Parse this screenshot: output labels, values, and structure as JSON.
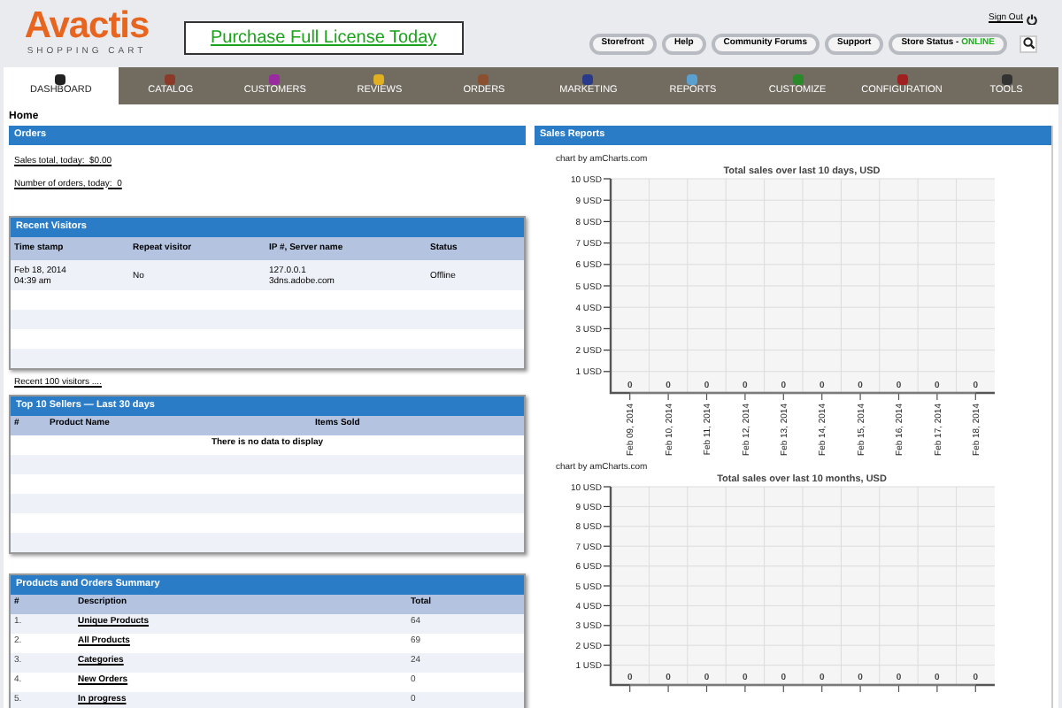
{
  "header": {
    "logo": "Avactis",
    "logo_subtitle": "SHOPPING CART",
    "banner": "Purchase Full License Today",
    "sign_out": "Sign Out",
    "buttons": [
      "Storefront",
      "Help",
      "Community Forums",
      "Support"
    ],
    "store_status": {
      "label": "Store Status - ",
      "status": "ONLINE"
    }
  },
  "tabs": [
    {
      "label": "DASHBOARD",
      "selected": true
    },
    {
      "label": "CATALOG",
      "selected": false
    },
    {
      "label": "CUSTOMERS",
      "selected": false
    },
    {
      "label": "REVIEWS",
      "selected": false
    },
    {
      "label": "ORDERS",
      "selected": false
    },
    {
      "label": "MARKETING",
      "selected": false
    },
    {
      "label": "REPORTS",
      "selected": false
    },
    {
      "label": "CUSTOMIZE",
      "selected": false
    },
    {
      "label": "CONFIGURATION",
      "selected": false
    },
    {
      "label": "TOOLS",
      "selected": false
    }
  ],
  "breadcrumb": "Home",
  "orders": {
    "title": "Orders",
    "links": [
      "Sales total, today:  $0.00",
      "Number of orders, today:  0"
    ]
  },
  "recent_visitors": {
    "title": "Recent Visitors",
    "columns": [
      "Time stamp",
      "Repeat visitor",
      "IP #, Server name",
      "Status"
    ],
    "rows": [
      {
        "cells": [
          [
            "Feb 18, 2014",
            "04:39 am"
          ],
          [
            "No"
          ],
          [
            "127.0.0.1",
            "3dns.adobe.com"
          ],
          [
            "Offline"
          ]
        ]
      }
    ],
    "link": "Recent 100 visitors ...."
  },
  "top_sellers": {
    "title": "Top 10 Sellers — Last 30 days",
    "columns": [
      "#",
      "Product Name",
      "Items Sold"
    ],
    "message": "There is no data to display"
  },
  "summary": {
    "title": "Products and Orders Summary",
    "columns": [
      "#",
      "Description",
      "Total"
    ],
    "rows": [
      {
        "num": "1.",
        "description": "Unique Products",
        "total": "64"
      },
      {
        "num": "2.",
        "description": "All Products",
        "total": "69"
      },
      {
        "num": "3.",
        "description": "Categories",
        "total": "24"
      },
      {
        "num": "4.",
        "description": "New Orders",
        "total": "0"
      },
      {
        "num": "5.",
        "description": "In progress",
        "total": "0"
      }
    ]
  },
  "sales_reports": {
    "title": "Sales Reports",
    "charts": [
      {
        "credit": "chart by amCharts.com",
        "chart_data": {
          "type": "line",
          "title": "Total sales over last 10 days, USD",
          "categories": [
            "Feb 09, 2014",
            "Feb 10, 2014",
            "Feb 11, 2014",
            "Feb 12, 2014",
            "Feb 13, 2014",
            "Feb 14, 2014",
            "Feb 15, 2014",
            "Feb 16, 2014",
            "Feb 17, 2014",
            "Feb 18, 2014"
          ],
          "series": [
            {
              "color": "#888888",
              "values": [
                0,
                0,
                0,
                0,
                0,
                0,
                0,
                0,
                0,
                0
              ]
            }
          ],
          "grid": true,
          "ylim": [
            0,
            10
          ],
          "yticks": [
            {
              "value": 1,
              "label": "1 USD"
            },
            {
              "value": 2,
              "label": "2 USD"
            },
            {
              "value": 3,
              "label": "3 USD"
            },
            {
              "value": 4,
              "label": "4 USD"
            },
            {
              "value": 5,
              "label": "5 USD"
            },
            {
              "value": 6,
              "label": "6 USD"
            },
            {
              "value": 7,
              "label": "7 USD"
            },
            {
              "value": 8,
              "label": "8 USD"
            },
            {
              "value": 9,
              "label": "9 USD"
            },
            {
              "value": 10,
              "label": "10 USD"
            }
          ],
          "data_labels": true
        }
      },
      {
        "credit": "chart by amCharts.com",
        "chart_data": {
          "type": "line",
          "title": "Total sales over last 10 months, USD",
          "series": [
            {
              "color": "#888888",
              "values": [
                0,
                0,
                0,
                0,
                0,
                0,
                0,
                0,
                0,
                0
              ]
            }
          ],
          "grid": true,
          "ylim": [
            0,
            10
          ],
          "yticks": [
            {
              "value": 1,
              "label": "1 USD"
            },
            {
              "value": 2,
              "label": "2 USD"
            },
            {
              "value": 3,
              "label": "3 USD"
            },
            {
              "value": 4,
              "label": "4 USD"
            },
            {
              "value": 5,
              "label": "5 USD"
            },
            {
              "value": 6,
              "label": "6 USD"
            },
            {
              "value": 7,
              "label": "7 USD"
            },
            {
              "value": 8,
              "label": "8 USD"
            },
            {
              "value": 9,
              "label": "9 USD"
            },
            {
              "value": 10,
              "label": "10 USD"
            }
          ],
          "data_labels": true
        }
      }
    ]
  }
}
